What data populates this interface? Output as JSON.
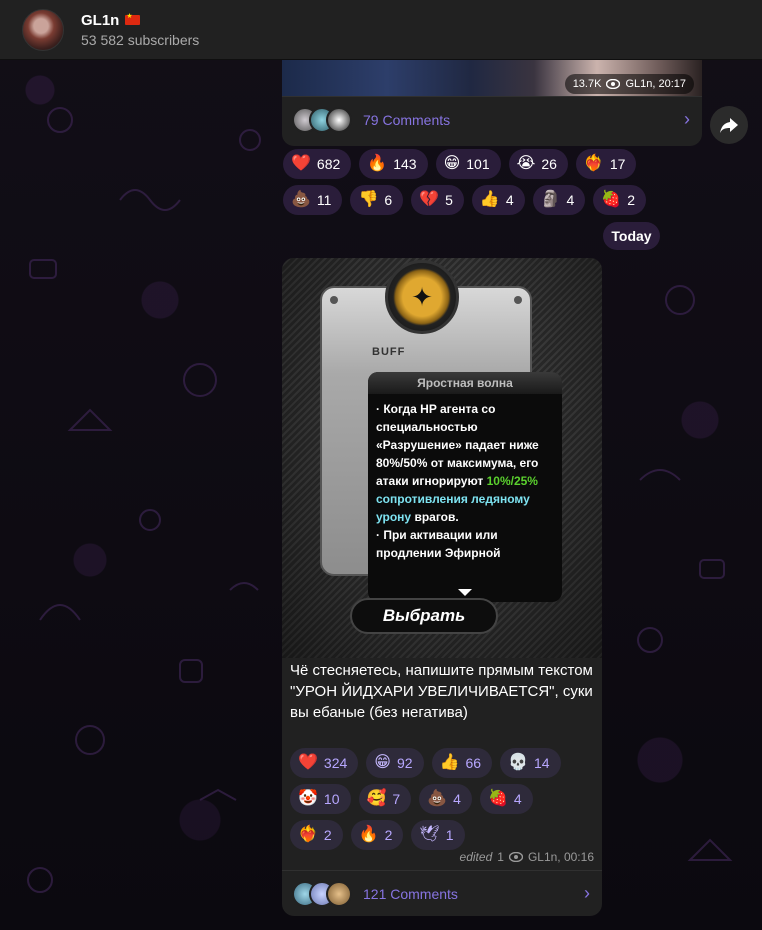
{
  "channel": {
    "name": "GL1n",
    "subscribers": "53 582 subscribers"
  },
  "prev_post": {
    "views": "13.7K",
    "author_time": "GL1n, 20:17",
    "comments_label": "79 Comments",
    "reactions": [
      {
        "emoji": "❤️",
        "count": "682"
      },
      {
        "emoji": "🔥",
        "count": "143"
      },
      {
        "emoji": "😁",
        "count": "101"
      },
      {
        "emoji": "😭",
        "count": "26"
      },
      {
        "emoji": "❤️‍🔥",
        "count": "17"
      },
      {
        "emoji": "💩",
        "count": "11"
      },
      {
        "emoji": "👎",
        "count": "6"
      },
      {
        "emoji": "💔",
        "count": "5"
      },
      {
        "emoji": "👍",
        "count": "4"
      },
      {
        "emoji": "🗿",
        "count": "4"
      },
      {
        "emoji": "🍓",
        "count": "2"
      }
    ]
  },
  "date_separator": "Today",
  "post": {
    "image": {
      "badge_label": "BUFF",
      "panel_title": "Яростная волна",
      "panel_text_1": "· Когда HP агента со специальностью «Разрушение» падает ниже 80%/50% от максимума, его атаки игнорируют ",
      "panel_text_green": "10%/25%",
      "panel_text_cyan": "сопротивления ледяному урону",
      "panel_text_2": " врагов.",
      "panel_text_3": "· При активации или продлении Эфирной",
      "button_label": "Выбрать"
    },
    "caption": "Чё стесняетесь, напишите прямым текстом \"УРОН ЙИДХАРИ УВЕЛИЧИВАЕТСЯ\", суки вы ебаные (без негатива)",
    "reactions": [
      {
        "emoji": "❤️",
        "count": "324"
      },
      {
        "emoji": "😁",
        "count": "92"
      },
      {
        "emoji": "👍",
        "count": "66"
      },
      {
        "emoji": "💀",
        "count": "14"
      },
      {
        "emoji": "🤡",
        "count": "10"
      },
      {
        "emoji": "🥰",
        "count": "7"
      },
      {
        "emoji": "💩",
        "count": "4"
      },
      {
        "emoji": "🍓",
        "count": "4"
      },
      {
        "emoji": "❤️‍🔥",
        "count": "2"
      },
      {
        "emoji": "🔥",
        "count": "2"
      },
      {
        "emoji": "🕊",
        "count": "1"
      }
    ],
    "edited_label": "edited",
    "views": "1",
    "author_time": "GL1n, 00:16",
    "comments_label": "121 Comments"
  },
  "colors": {
    "accent": "#8774e1",
    "bubble": "#212121",
    "reaction_bg": "#2a1d3a"
  }
}
